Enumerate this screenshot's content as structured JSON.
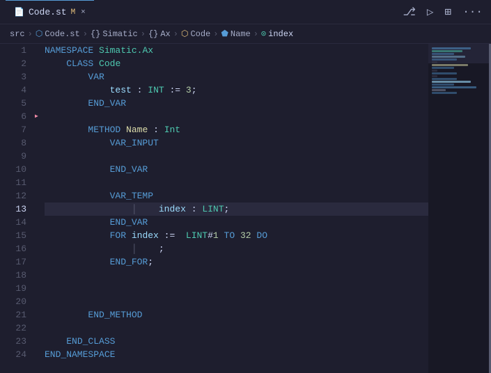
{
  "titlebar": {
    "tab_label": "Code.st",
    "tab_modified": "M",
    "tab_close": "×",
    "action_icons": [
      "source-control",
      "run",
      "layout",
      "more"
    ]
  },
  "breadcrumb": {
    "items": [
      {
        "label": "src",
        "icon": ""
      },
      {
        "label": "Code.st",
        "icon": "📄"
      },
      {
        "label": "Simatic",
        "icon": "{}"
      },
      {
        "label": "Ax",
        "icon": "{}"
      },
      {
        "label": "Code",
        "icon": "🔶"
      },
      {
        "label": "Name",
        "icon": "🔷"
      },
      {
        "label": "index",
        "icon": "🔵"
      }
    ]
  },
  "editor": {
    "lines": [
      {
        "num": "1",
        "content": "NAMESPACE_LINE",
        "active": false
      },
      {
        "num": "2",
        "content": "CLASS_LINE",
        "active": false
      },
      {
        "num": "3",
        "content": "VAR_LINE",
        "active": false
      },
      {
        "num": "4",
        "content": "TEST_LINE",
        "active": false
      },
      {
        "num": "5",
        "content": "ENDVAR_LINE",
        "active": false
      },
      {
        "num": "6",
        "content": "EMPTY",
        "active": false
      },
      {
        "num": "7",
        "content": "METHOD_LINE",
        "active": false
      },
      {
        "num": "8",
        "content": "VARINPUT_LINE",
        "active": false
      },
      {
        "num": "9",
        "content": "EMPTY",
        "active": false
      },
      {
        "num": "10",
        "content": "ENDVAR2_LINE",
        "active": false
      },
      {
        "num": "11",
        "content": "EMPTY",
        "active": false
      },
      {
        "num": "12",
        "content": "VARTEMP_LINE",
        "active": false
      },
      {
        "num": "13",
        "content": "INDEX_LINE",
        "active": true
      },
      {
        "num": "14",
        "content": "ENDVAR3_LINE",
        "active": false
      },
      {
        "num": "15",
        "content": "FOR_LINE",
        "active": false
      },
      {
        "num": "16",
        "content": "SEMICOLON_LINE",
        "active": false
      },
      {
        "num": "17",
        "content": "ENDFOR_LINE",
        "active": false
      },
      {
        "num": "18",
        "content": "EMPTY",
        "active": false
      },
      {
        "num": "19",
        "content": "EMPTY",
        "active": false
      },
      {
        "num": "20",
        "content": "EMPTY",
        "active": false
      },
      {
        "num": "21",
        "content": "ENDMETHOD_LINE",
        "active": false
      },
      {
        "num": "22",
        "content": "EMPTY",
        "active": false
      },
      {
        "num": "23",
        "content": "ENDCLASS_LINE",
        "active": false
      },
      {
        "num": "24",
        "content": "ENDNAMESPACE_LINE",
        "active": false
      }
    ]
  },
  "colors": {
    "bg": "#1e1e2e",
    "active_line": "#2a2a3e",
    "keyword": "#569cd6",
    "identifier": "#9cdcfe",
    "type": "#4ec9b0",
    "number": "#b5cea8",
    "method": "#dcdcaa"
  }
}
